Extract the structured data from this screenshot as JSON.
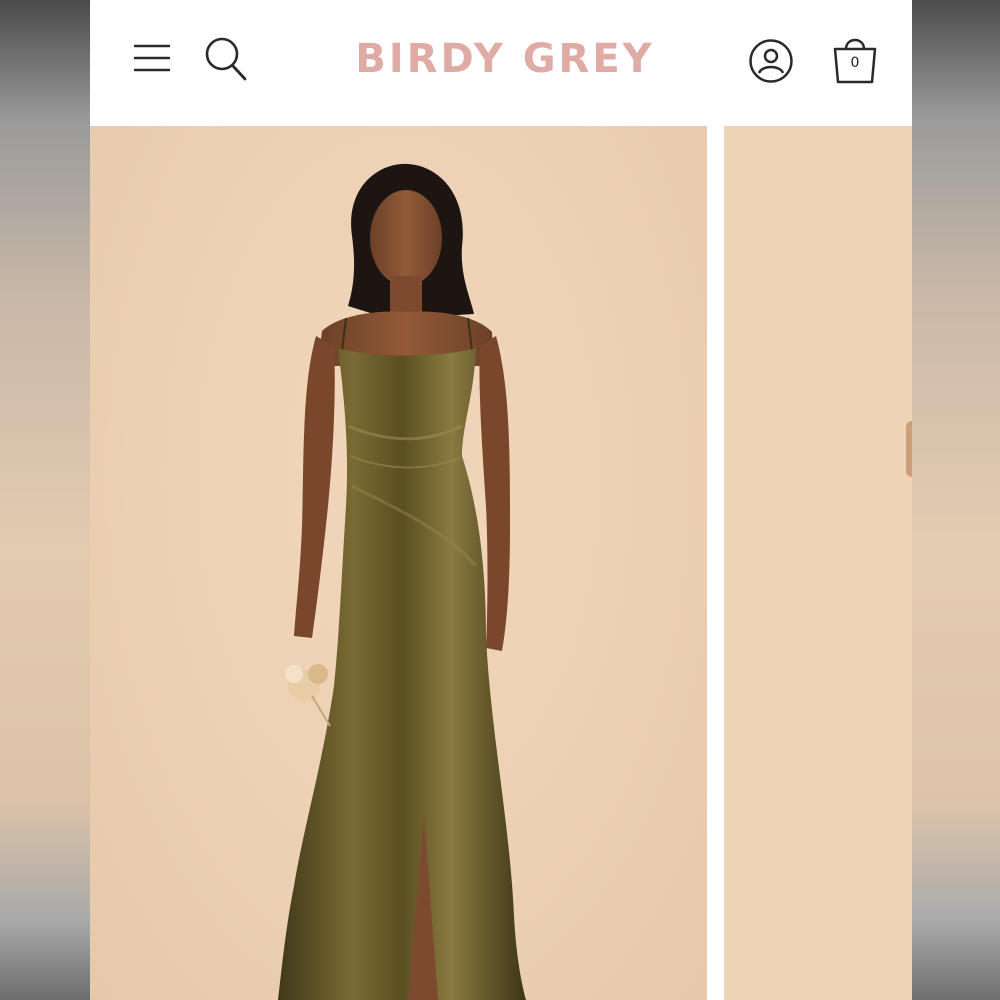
{
  "header": {
    "brand": "BIRDY GREY",
    "cart_count": "0",
    "icons": {
      "menu": "hamburger-menu-icon",
      "search": "search-icon",
      "account": "user-account-icon",
      "cart": "shopping-bag-icon"
    }
  },
  "gallery": {
    "current_image": "model-in-olive-satin-gown-photo",
    "next_image": "next-product-photo"
  },
  "colors": {
    "brand": "#e0aaa5",
    "background": "#ecd0b3",
    "dress": "#5e5326"
  }
}
